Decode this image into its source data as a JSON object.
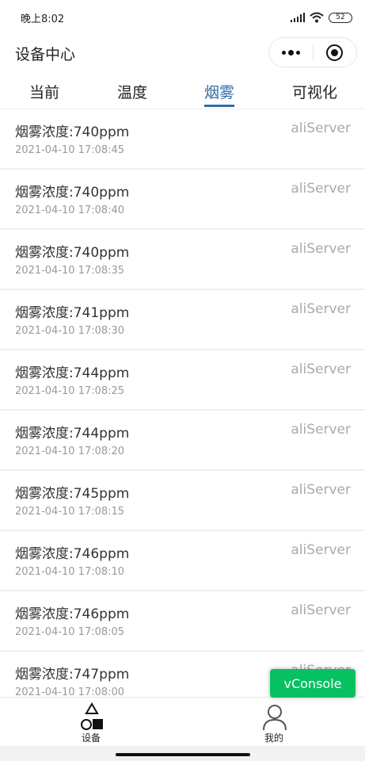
{
  "status_bar": {
    "time": "晚上8:02",
    "battery": "52",
    "signal_icon": "signal-icon",
    "wifi_icon": "wifi-icon"
  },
  "nav": {
    "title": "设备中心",
    "more_icon": "more-dots-icon",
    "close_icon": "target-close-icon"
  },
  "tabs": [
    {
      "label": "当前"
    },
    {
      "label": "温度"
    },
    {
      "label": "烟雾",
      "active": true
    },
    {
      "label": "可视化"
    }
  ],
  "accent_color": "#2e6da4",
  "records": [
    {
      "title": "烟雾浓度:740ppm",
      "time": "2021-04-10 17:08:45",
      "source": "aliServer"
    },
    {
      "title": "烟雾浓度:740ppm",
      "time": "2021-04-10 17:08:40",
      "source": "aliServer"
    },
    {
      "title": "烟雾浓度:740ppm",
      "time": "2021-04-10 17:08:35",
      "source": "aliServer"
    },
    {
      "title": "烟雾浓度:741ppm",
      "time": "2021-04-10 17:08:30",
      "source": "aliServer"
    },
    {
      "title": "烟雾浓度:744ppm",
      "time": "2021-04-10 17:08:25",
      "source": "aliServer"
    },
    {
      "title": "烟雾浓度:744ppm",
      "time": "2021-04-10 17:08:20",
      "source": "aliServer"
    },
    {
      "title": "烟雾浓度:745ppm",
      "time": "2021-04-10 17:08:15",
      "source": "aliServer"
    },
    {
      "title": "烟雾浓度:746ppm",
      "time": "2021-04-10 17:08:10",
      "source": "aliServer"
    },
    {
      "title": "烟雾浓度:746ppm",
      "time": "2021-04-10 17:08:05",
      "source": "aliServer"
    },
    {
      "title": "烟雾浓度:747ppm",
      "time": "2021-04-10 17:08:00",
      "source": "aliServer"
    }
  ],
  "vconsole": {
    "label": "vConsole",
    "color": "#07c160"
  },
  "tabbar": [
    {
      "label": "设备",
      "icon": "shapes-icon"
    },
    {
      "label": "我的",
      "icon": "person-icon"
    }
  ]
}
